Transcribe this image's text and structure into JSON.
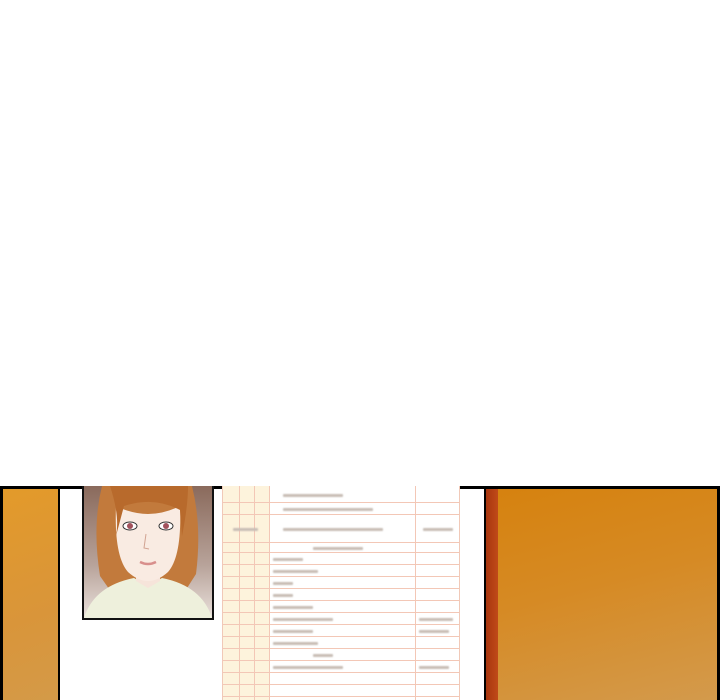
{
  "colors": {
    "panel_orange": "#d6820f",
    "left_strip": "#e39a2a",
    "red_strip": "#a8360f",
    "form_line": "#f3c7b6",
    "form_header": "#fdf3dc"
  },
  "icons": [
    "portrait-illustration",
    "blurred-resume-document"
  ]
}
